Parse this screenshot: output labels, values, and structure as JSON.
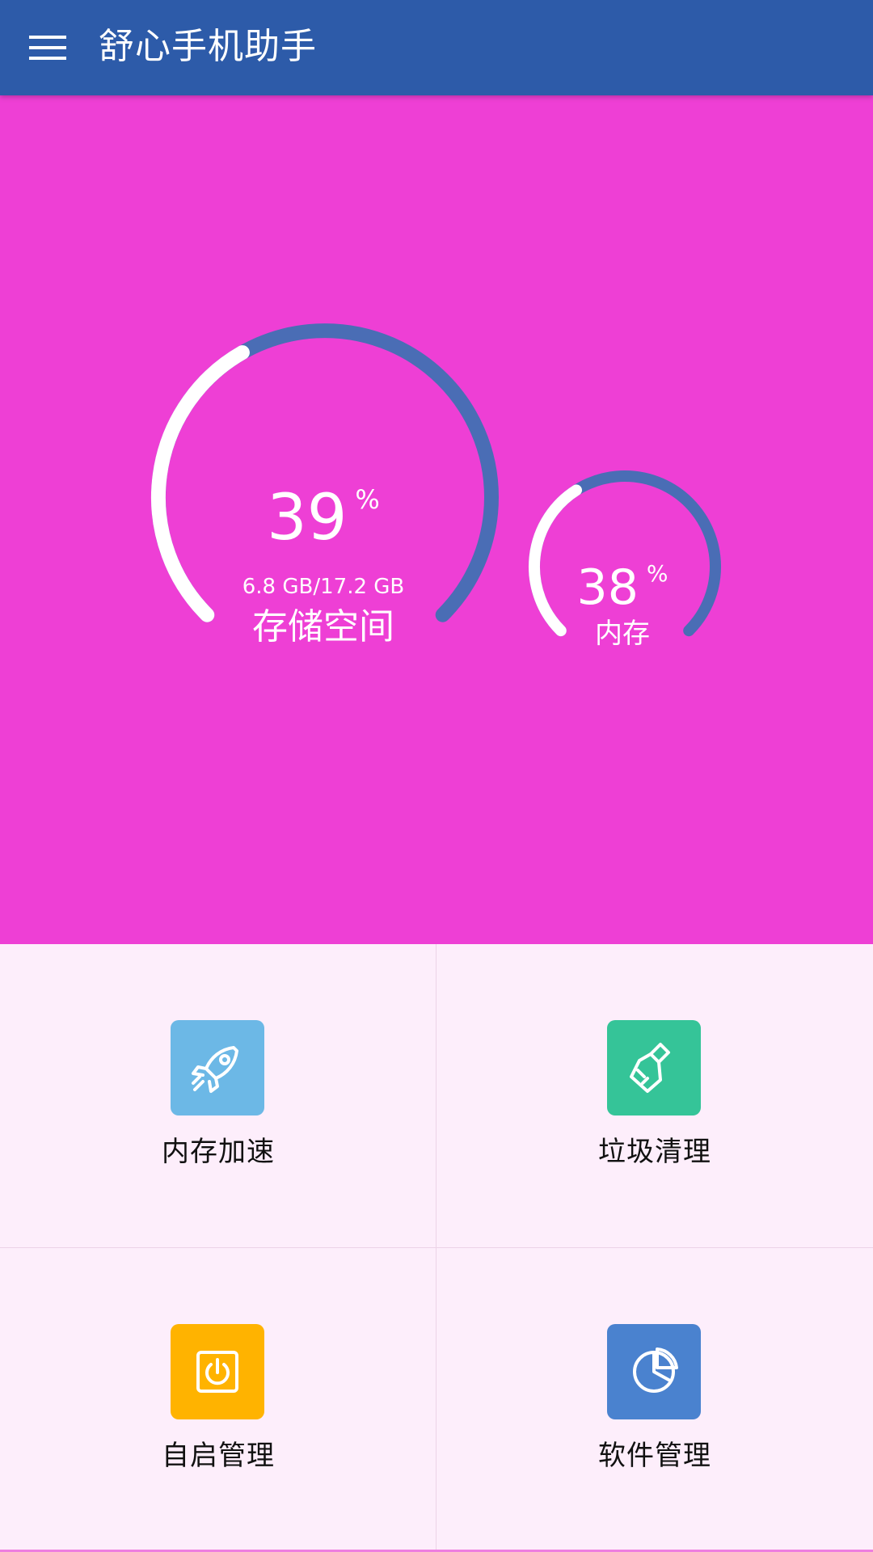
{
  "app_bar": {
    "title": "舒心手机助手",
    "menu_icon": "menu-icon",
    "color": "#2d5ba9"
  },
  "dashboard": {
    "background": "#ee3fd5",
    "storage": {
      "percent": "39",
      "percent_sign": "%",
      "usage": "6.8 GB/17.2 GB",
      "label": "存储空间",
      "fraction": 0.39
    },
    "memory": {
      "percent": "38",
      "percent_sign": "%",
      "label": "内存",
      "fraction": 0.38
    },
    "track_color": "#4a6db5",
    "progress_color": "#ffffff"
  },
  "tools": [
    {
      "label": "内存加速",
      "icon": "rocket-icon",
      "color": "#6cb8e6"
    },
    {
      "label": "垃圾清理",
      "icon": "broom-icon",
      "color": "#35c498"
    },
    {
      "label": "自启管理",
      "icon": "power-icon",
      "color": "#ffb300"
    },
    {
      "label": "软件管理",
      "icon": "pie-chart-icon",
      "color": "#4a82cf"
    }
  ]
}
